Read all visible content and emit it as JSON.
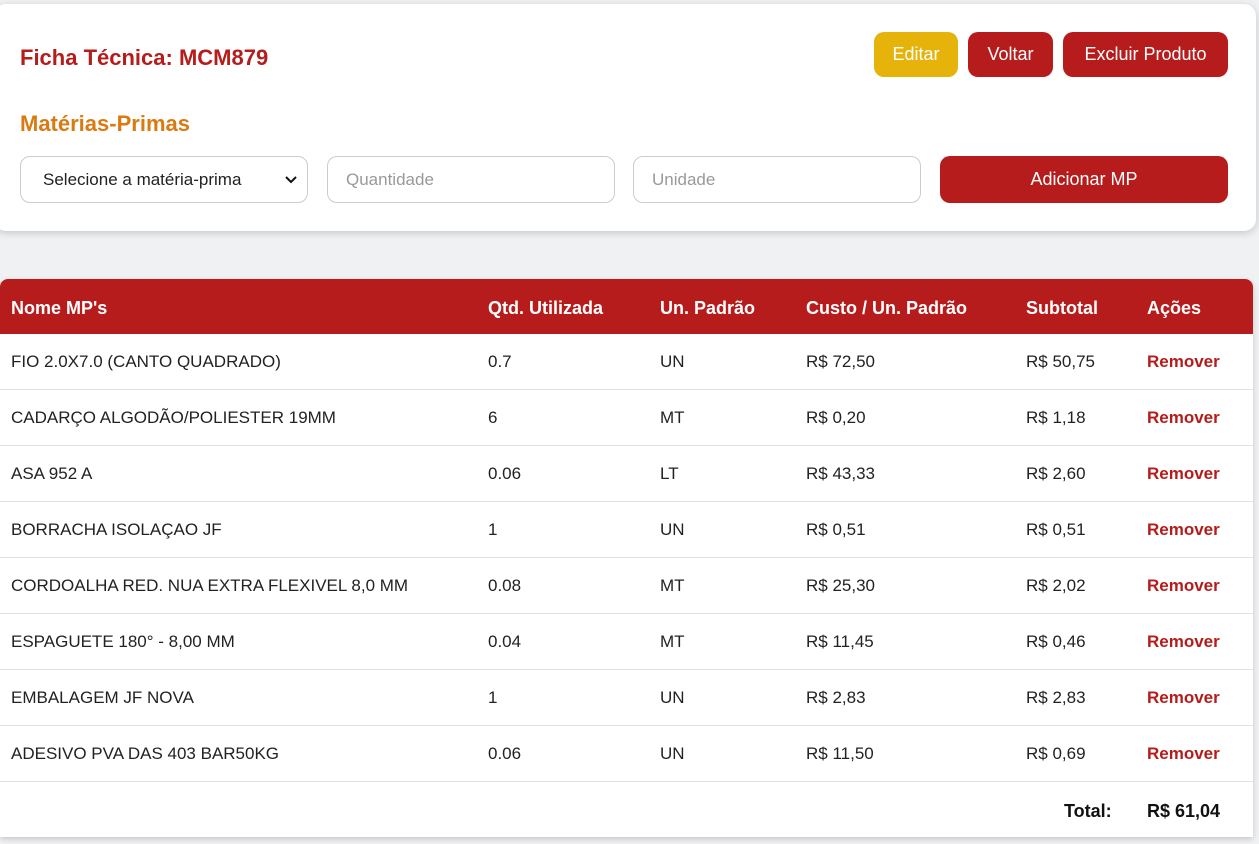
{
  "header": {
    "title": "Ficha Técnica: MCM879",
    "edit_label": "Editar",
    "back_label": "Voltar",
    "delete_label": "Excluir Produto"
  },
  "form": {
    "section_title": "Matérias-Primas",
    "select_value": "Selecione a matéria-prima",
    "quantity_placeholder": "Quantidade",
    "unit_placeholder": "Unidade",
    "add_label": "Adicionar MP"
  },
  "table": {
    "headers": [
      "Nome MP's",
      "Qtd. Utilizada",
      "Un. Padrão",
      "Custo / Un. Padrão",
      "Subtotal",
      "Ações"
    ],
    "rows": [
      {
        "name": "FIO 2.0X7.0 (CANTO QUADRADO)",
        "qty": "0.7",
        "unit": "UN",
        "cost": "R$ 72,50",
        "subtotal": "R$ 50,75",
        "action": "Remover"
      },
      {
        "name": "CADARÇO ALGODÃO/POLIESTER 19MM",
        "qty": "6",
        "unit": "MT",
        "cost": "R$ 0,20",
        "subtotal": "R$ 1,18",
        "action": "Remover"
      },
      {
        "name": "ASA 952 A",
        "qty": "0.06",
        "unit": "LT",
        "cost": "R$ 43,33",
        "subtotal": "R$ 2,60",
        "action": "Remover"
      },
      {
        "name": "BORRACHA ISOLAÇAO JF",
        "qty": "1",
        "unit": "UN",
        "cost": "R$ 0,51",
        "subtotal": "R$ 0,51",
        "action": "Remover"
      },
      {
        "name": "CORDOALHA RED. NUA EXTRA FLEXIVEL 8,0 MM",
        "qty": "0.08",
        "unit": "MT",
        "cost": "R$ 25,30",
        "subtotal": "R$ 2,02",
        "action": "Remover"
      },
      {
        "name": "ESPAGUETE 180° - 8,00 MM",
        "qty": "0.04",
        "unit": "MT",
        "cost": "R$ 11,45",
        "subtotal": "R$ 0,46",
        "action": "Remover"
      },
      {
        "name": "EMBALAGEM JF NOVA",
        "qty": "1",
        "unit": "UN",
        "cost": "R$ 2,83",
        "subtotal": "R$ 2,83",
        "action": "Remover"
      },
      {
        "name": "ADESIVO PVA DAS 403 BAR50KG",
        "qty": "0.06",
        "unit": "UN",
        "cost": "R$ 11,50",
        "subtotal": "R$ 0,69",
        "action": "Remover"
      }
    ],
    "total_label": "Total:",
    "total_value": "R$ 61,04"
  },
  "colors": {
    "primary": "#b71c1c",
    "edit": "#e6b30b",
    "section_title": "#d97b12"
  }
}
